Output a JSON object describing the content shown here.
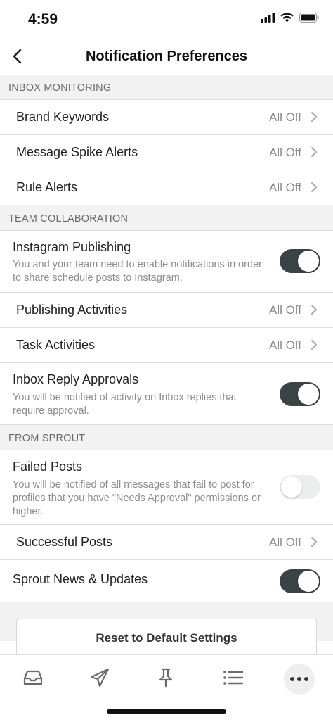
{
  "status_bar": {
    "time": "4:59"
  },
  "nav": {
    "title": "Notification Preferences"
  },
  "sections": {
    "inbox_monitoring": {
      "header": "INBOX MONITORING",
      "brand_keywords": {
        "label": "Brand Keywords",
        "value": "All Off"
      },
      "message_spike_alerts": {
        "label": "Message Spike Alerts",
        "value": "All Off"
      },
      "rule_alerts": {
        "label": "Rule Alerts",
        "value": "All Off"
      }
    },
    "team_collaboration": {
      "header": "TEAM COLLABORATION",
      "instagram_publishing": {
        "label": "Instagram Publishing",
        "description": "You and your team need to enable notifications in order to share schedule posts to Instagram.",
        "enabled": true
      },
      "publishing_activities": {
        "label": "Publishing Activities",
        "value": "All Off"
      },
      "task_activities": {
        "label": "Task Activities",
        "value": "All Off"
      },
      "inbox_reply_approvals": {
        "label": "Inbox Reply Approvals",
        "description": "You will be notified of activity on Inbox replies that require approval.",
        "enabled": true
      }
    },
    "from_sprout": {
      "header": "FROM SPROUT",
      "failed_posts": {
        "label": "Failed Posts",
        "description": "You will be notified of all messages that fail to post for profiles that you have \"Needs Approval\" permissions or higher.",
        "enabled": false
      },
      "successful_posts": {
        "label": "Successful Posts",
        "value": "All Off"
      },
      "sprout_news": {
        "label": "Sprout News & Updates",
        "enabled": true
      }
    }
  },
  "reset_button": {
    "label": "Reset to Default Settings"
  },
  "tab_bar": {
    "tabs": [
      {
        "icon": "inbox-icon"
      },
      {
        "icon": "paper-plane-icon"
      },
      {
        "icon": "pin-icon"
      },
      {
        "icon": "list-icon"
      },
      {
        "icon": "more-icon",
        "active": true
      }
    ]
  },
  "colors": {
    "toggle_on": "#3b4344",
    "toggle_off": "#eceeee",
    "section_bg": "#f2f2f2",
    "secondary_text": "#8a8a8a"
  }
}
